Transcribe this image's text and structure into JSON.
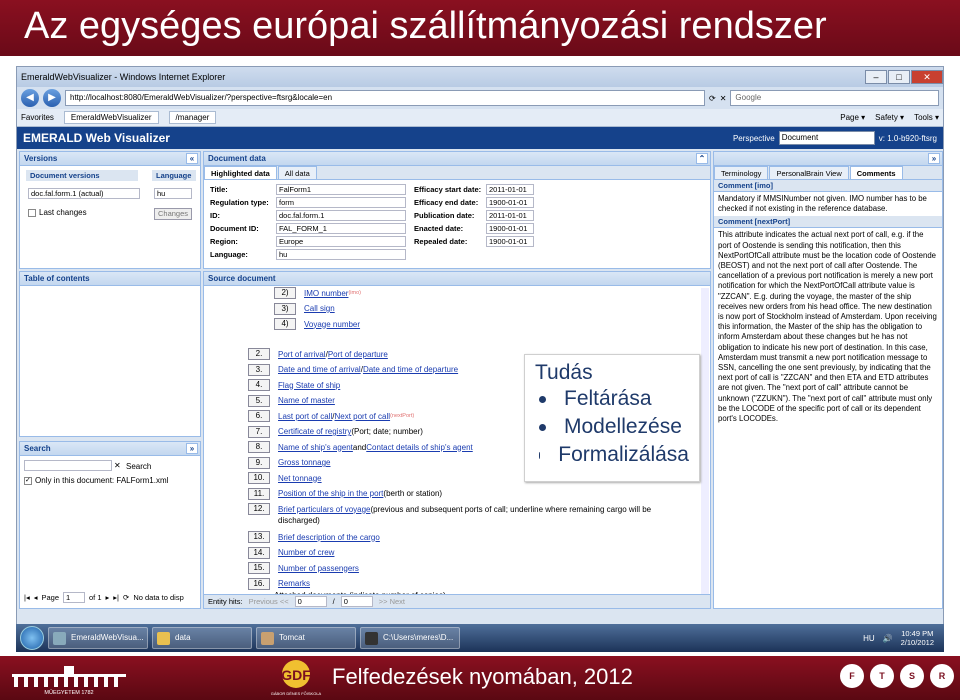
{
  "slide": {
    "title": "Az egységes európai szállítmányozási rendszer",
    "footer": "Felfedezések nyomában, 2012",
    "university": "MŰEGYETEM 1782",
    "logo_text": "GÁBOR DÉNES FŐISKOLA",
    "logos": [
      "F",
      "T",
      "S",
      "R"
    ]
  },
  "browser": {
    "window_title": "EmeraldWebVisualizer - Windows Internet Explorer",
    "url": "http://localhost:8080/EmeraldWebVisualizer/?perspective=ftsrg&locale=en",
    "search_placeholder": "Google",
    "favorites": "Favorites",
    "tabs": [
      "EmeraldWebVisualizer",
      "/manager"
    ],
    "tools": [
      "Page ▾",
      "Safety ▾",
      "Tools ▾"
    ]
  },
  "app": {
    "name": "EMERALD Web Visualizer",
    "perspective_label": "Perspective",
    "perspective_value": "Document",
    "version": "v: 1.0-b920-ftsrg"
  },
  "left": {
    "versions_title": "Versions",
    "doc_versions_label": "Document versions",
    "doc_version_value": "doc.fal.form.1 (actual)",
    "language_label": "Language",
    "language_value": "hu",
    "last_changes": "Last changes",
    "changes_button": "Changes",
    "toc_title": "Table of contents",
    "search_title": "Search",
    "search_button": "Search",
    "only_doc": "Only in this document: FALForm1.xml",
    "page_label": "Page",
    "page_value": "1",
    "of_label": "of 1",
    "no_data": "No data to disp"
  },
  "docdata": {
    "title": "Document data",
    "tabs": [
      "Highlighted data",
      "All data"
    ],
    "left_fields": [
      {
        "label": "Title:",
        "value": "FalForm1"
      },
      {
        "label": "Regulation type:",
        "value": "form"
      },
      {
        "label": "ID:",
        "value": "doc.fal.form.1"
      },
      {
        "label": "Document ID:",
        "value": "FAL_FORM_1"
      },
      {
        "label": "Region:",
        "value": "Europe"
      },
      {
        "label": "Language:",
        "value": "hu"
      }
    ],
    "right_fields": [
      {
        "label": "Efficacy start date:",
        "value": "2011-01-01"
      },
      {
        "label": "Efficacy end date:",
        "value": "1900-01-01"
      },
      {
        "label": "Publication date:",
        "value": "2011-01-01"
      },
      {
        "label": "Enacted date:",
        "value": "1900-01-01"
      },
      {
        "label": "Repealed date:",
        "value": "1900-01-01"
      }
    ]
  },
  "source": {
    "title": "Source document",
    "items_top": [
      {
        "num": "2)",
        "text": "IMO number",
        "sub": "(imo)"
      },
      {
        "num": "3)",
        "text": "Call sign"
      },
      {
        "num": "4)",
        "text": "Voyage number"
      }
    ],
    "items": [
      {
        "num": "2.",
        "a": "Port of arrival",
        "sep": " / ",
        "b": "Port of departure"
      },
      {
        "num": "3.",
        "a": "Date and time of arrival",
        "sep": " / ",
        "b": "Date and time of departure"
      },
      {
        "num": "4.",
        "a": "Flag State of ship"
      },
      {
        "num": "5.",
        "a": "Name of master"
      },
      {
        "num": "6.",
        "a": "Last port of call",
        "sep": " / ",
        "b": "Next port of call",
        "sub": "(nextPort)"
      },
      {
        "num": "7.",
        "a": "Certificate of registry",
        "rest": " (Port; date; number)"
      },
      {
        "num": "8.",
        "a": "Name of ship's agent",
        "rest": " and ",
        "b": "Contact details of ship's agent"
      },
      {
        "num": "9.",
        "a": "Gross tonnage"
      },
      {
        "num": "10.",
        "a": "Net tonnage"
      },
      {
        "num": "11.",
        "a": "Position of the ship in the port",
        "rest": " (berth or station)"
      },
      {
        "num": "12.",
        "a": "Brief particulars of voyage",
        "rest": " (previous and subsequent ports of call; underline where remaining cargo will be",
        "rest2": "discharged)"
      },
      {
        "num": "13.",
        "a": "Brief description of the cargo"
      },
      {
        "num": "14.",
        "a": "Number of crew"
      },
      {
        "num": "15.",
        "a": "Number of passengers"
      },
      {
        "num": "16.",
        "a": "Remarks"
      }
    ],
    "cutoff": "Attached documents (indicate number of copies)",
    "entity_hits": "Entity hits:",
    "previous": "Previous <<",
    "slash": "/",
    "next": ">> Next",
    "hit_a": "0",
    "hit_b": "0"
  },
  "right": {
    "tabs": [
      "Terminology",
      "PersonalBrain View",
      "Comments"
    ],
    "c1_title": "Comment [imo]",
    "c1_body": "Mandatory if MMSINumber not given. IMO number has to be checked if not existing in the reference database.",
    "c2_title": "Comment [nextPort]",
    "c2_body": "This attribute indicates the actual next port of call, e.g. if the port of Oostende is sending this notification, then this NextPortOfCall attribute must be the location code of Oostende (BEOST) and not the next port of call after Oostende. The cancellation of a previous port notification is merely a new port notification for which the NextPortOfCall attribute value is \"ZZCAN\". E.g. during the voyage, the master of the ship receives new orders from his head office. The new destination is now port of Stockholm instead of Amsterdam. Upon receiving this information, the Master of the ship has the obligation to inform Amsterdam about these changes but he has not obligation to indicate his new port of destination. In this case, Amsterdam must transmit a new port notification message to SSN, cancelling the one sent previously, by indicating that the next port of call is \"ZZCAN\" and then ETA and ETD attributes are not given. The \"next port of call\" attribute cannot be unknown (\"ZZUKN\"). The \"next port of call\" attribute must only be the LOCODE of the specific port of call or its dependent port's LOCODEs."
  },
  "callout": {
    "title": "Tudás",
    "items": [
      "Feltárása",
      "Modellezése",
      "Formalizálása"
    ]
  },
  "taskbar": {
    "buttons": [
      "EmeraldWebVisua...",
      "data",
      "Tomcat",
      "C:\\Users\\meres\\D..."
    ],
    "lang": "HU",
    "time": "10:49 PM",
    "date": "2/10/2012"
  }
}
